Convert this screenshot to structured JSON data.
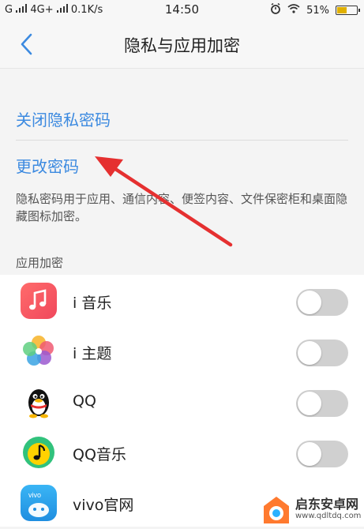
{
  "status_bar": {
    "signal_left": "G",
    "network": "4G+",
    "speed": "0.1K/s",
    "time": "14:50",
    "battery_pct": "51%",
    "battery_level": 0.51
  },
  "header": {
    "title": "隐私与应用加密"
  },
  "privacy": {
    "close_password": "关闭隐私密码",
    "change_password": "更改密码",
    "description": "隐私密码用于应用、通信内容、便签内容、文件保密柜和桌面隐藏图标加密。"
  },
  "apps_section": {
    "label": "应用加密",
    "items": [
      {
        "name": "i 音乐",
        "icon": "music-note-icon",
        "enabled": false
      },
      {
        "name": "i 主题",
        "icon": "theme-pinwheel-icon",
        "enabled": false
      },
      {
        "name": "QQ",
        "icon": "qq-penguin-icon",
        "enabled": false
      },
      {
        "name": "QQ音乐",
        "icon": "qq-music-icon",
        "enabled": false
      },
      {
        "name": "vivo官网",
        "icon": "vivo-store-icon",
        "enabled": false
      }
    ]
  },
  "watermark": {
    "name": "启东安卓网",
    "url": "www.qdltdq.com"
  },
  "colors": {
    "accent": "#3c8ae0",
    "arrow": "#e53030",
    "toggle_off": "#d0d0d0"
  }
}
